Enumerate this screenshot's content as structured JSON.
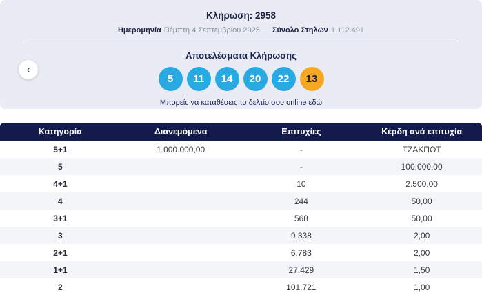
{
  "draw": {
    "title": "Κλήρωση: 2958",
    "date_label": "Ημερομηνία",
    "date_value": "Πέμπτη 4 Σεπτεμβρίου 2025",
    "columns_label": "Σύνολο Στηλών",
    "columns_value": "1.112.491"
  },
  "results": {
    "title": "Αποτελέσματα Κλήρωσης",
    "numbers": [
      "5",
      "11",
      "14",
      "20",
      "22"
    ],
    "joker_number": "13",
    "deposit_text": "Μπορείς να καταθέσεις το δελτίο σου online",
    "deposit_link_word": "εδώ",
    "prev_arrow": "‹"
  },
  "colors": {
    "card_background": "#e9ecf4",
    "table_header_background": "#131b4d",
    "ball_blue": "#29a9e1",
    "ball_orange": "#f6a723",
    "navy_text": "#1b2450",
    "alt_row": "#f4f5f9"
  },
  "table": {
    "headers": [
      "Κατηγορία",
      "Διανεμόμενα",
      "Επιτυχίες",
      "Κέρδη ανά επιτυχία"
    ],
    "rows": [
      {
        "category": "5+1",
        "distributed": "1.000.000,00",
        "winners": "-",
        "prize": "ΤΖΑΚΠΟΤ"
      },
      {
        "category": "5",
        "distributed": "",
        "winners": "-",
        "prize": "100.000,00"
      },
      {
        "category": "4+1",
        "distributed": "",
        "winners": "10",
        "prize": "2.500,00"
      },
      {
        "category": "4",
        "distributed": "",
        "winners": "244",
        "prize": "50,00"
      },
      {
        "category": "3+1",
        "distributed": "",
        "winners": "568",
        "prize": "50,00"
      },
      {
        "category": "3",
        "distributed": "",
        "winners": "9.338",
        "prize": "2,00"
      },
      {
        "category": "2+1",
        "distributed": "",
        "winners": "6.783",
        "prize": "2,00"
      },
      {
        "category": "1+1",
        "distributed": "",
        "winners": "27.429",
        "prize": "1,50"
      },
      {
        "category": "2",
        "distributed": "",
        "winners": "101.721",
        "prize": "1,00"
      }
    ]
  }
}
